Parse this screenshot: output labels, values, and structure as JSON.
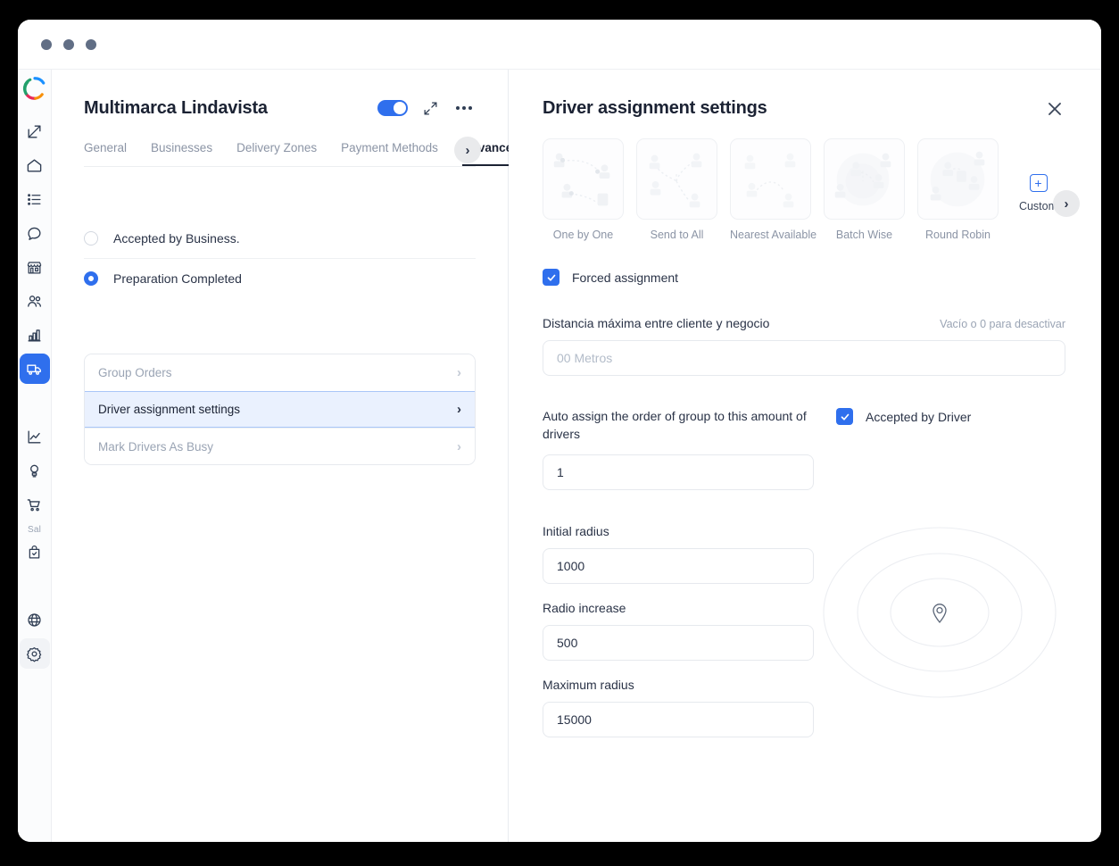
{
  "window": {
    "traffic_lights": [
      "dot",
      "dot",
      "dot"
    ]
  },
  "sidebar": {
    "logo": "brand-logo-icon",
    "items": [
      {
        "icon": "external-link-icon",
        "name": "external-link",
        "active": false
      },
      {
        "icon": "home-icon",
        "name": "home",
        "active": false
      },
      {
        "icon": "list-icon",
        "name": "orders-list",
        "active": false
      },
      {
        "icon": "chat-bubble-icon",
        "name": "messages",
        "active": false
      },
      {
        "icon": "store-icon",
        "name": "businesses",
        "active": false
      },
      {
        "icon": "users-icon",
        "name": "users",
        "active": false
      },
      {
        "icon": "bar-chart-icon",
        "name": "reports",
        "active": false
      },
      {
        "icon": "delivery-truck-icon",
        "name": "drivers",
        "active": true
      },
      {
        "icon": "line-chart-icon",
        "name": "analytics",
        "active": false
      },
      {
        "icon": "lightbulb-icon",
        "name": "marketing",
        "active": false
      },
      {
        "icon": "shopping-cart-icon",
        "name": "cart",
        "active": false
      }
    ],
    "section_label": "Sal",
    "items_bottom": [
      {
        "icon": "bag-check-icon",
        "name": "orders",
        "active": false
      },
      {
        "icon": "globe-icon",
        "name": "language",
        "active": false
      },
      {
        "icon": "gear-icon",
        "name": "settings",
        "active": false
      }
    ]
  },
  "left_panel": {
    "title": "Multimarca Lindavista",
    "toggle_on": true,
    "expand_icon": "expand-arrows-icon",
    "more_icon": "more-horizontal-icon",
    "tabs": [
      {
        "label": "General",
        "active": false
      },
      {
        "label": "Businesses",
        "active": false
      },
      {
        "label": "Delivery Zones",
        "active": false
      },
      {
        "label": "Payment Methods",
        "active": false
      },
      {
        "label": "Advanced",
        "active": true
      }
    ],
    "tabs_scroll_next": "›",
    "radios": [
      {
        "label": "Accepted by Business.",
        "selected": false
      },
      {
        "label": "Preparation Completed",
        "selected": true
      }
    ],
    "list": [
      {
        "label": "Group Orders",
        "selected": false
      },
      {
        "label": "Driver assignment settings",
        "selected": true
      },
      {
        "label": "Mark Drivers As Busy",
        "selected": false
      }
    ],
    "chevron": "›"
  },
  "right_panel": {
    "title": "Driver assignment settings",
    "close_icon": "close-icon",
    "methods": [
      {
        "label": "One by One",
        "thumb": "one-by-one-illustration"
      },
      {
        "label": "Send to All",
        "thumb": "send-to-all-illustration"
      },
      {
        "label": "Nearest Available",
        "thumb": "nearest-available-illustration"
      },
      {
        "label": "Batch Wise",
        "thumb": "batch-wise-illustration"
      },
      {
        "label": "Round Robin",
        "thumb": "round-robin-illustration"
      }
    ],
    "custom": {
      "label": "Custom",
      "plus": "+"
    },
    "methods_scroll_next": "›",
    "forced_assignment": {
      "label": "Forced assignment",
      "checked": true
    },
    "distance": {
      "label": "Distancia máxima entre cliente y negocio",
      "hint": "Vacío o 0 para desactivar",
      "value": "",
      "placeholder": "00 Metros"
    },
    "auto_assign": {
      "label": "Auto assign the order of group to this amount of drivers",
      "value": "1"
    },
    "accepted_by_driver": {
      "label": "Accepted by Driver",
      "checked": true
    },
    "initial_radius": {
      "label": "Initial radius",
      "value": "1000"
    },
    "radio_increase": {
      "label": "Radio increase",
      "value": "500"
    },
    "maximum_radius": {
      "label": "Maximum radius",
      "value": "15000"
    },
    "radar": {
      "icon": "map-pin-icon",
      "rings": 3
    }
  },
  "colors": {
    "accent": "#2f6fed",
    "text": "#2a3347",
    "muted": "#8b94a5",
    "border": "#e6e9ee",
    "selected_row_bg": "#eaf1fe"
  }
}
